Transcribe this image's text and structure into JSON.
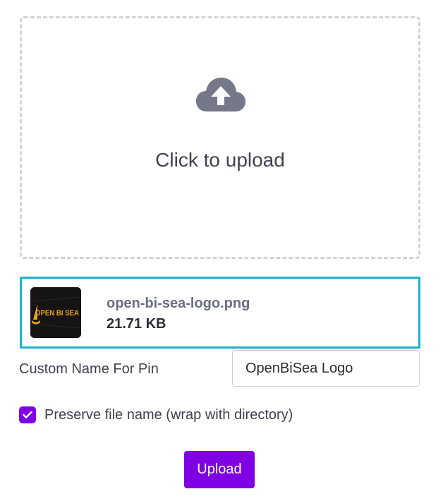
{
  "dropzone": {
    "icon": "cloud-upload-icon",
    "label": "Click to upload"
  },
  "selected_file": {
    "thumbnail": "openbisea-logo-thumbnail",
    "thumbnail_text": "OPEN BI SEA",
    "name": "open-bi-sea-logo.png",
    "size": "21.71 KB"
  },
  "pin_name": {
    "label": "Custom Name For Pin",
    "value": "OpenBiSea Logo"
  },
  "preserve_filename": {
    "checked": true,
    "icon": "check-icon",
    "label": "Preserve file name (wrap with directory)"
  },
  "upload_button": {
    "label": "Upload"
  },
  "colors": {
    "accent": "#8000e6",
    "selected_border": "#1ab3cf",
    "icon_gray": "#757889",
    "dashed_border": "#d4d4d6"
  }
}
